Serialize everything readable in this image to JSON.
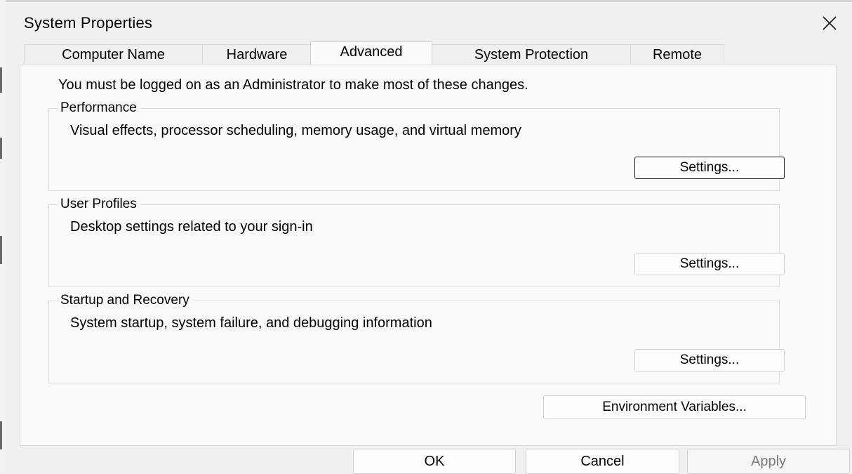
{
  "window": {
    "title": "System Properties"
  },
  "tabs": [
    {
      "label": "Computer Name",
      "active": false
    },
    {
      "label": "Hardware",
      "active": false
    },
    {
      "label": "Advanced",
      "active": true
    },
    {
      "label": "System Protection",
      "active": false
    },
    {
      "label": "Remote",
      "active": false
    }
  ],
  "advanced": {
    "notice": "You must be logged on as an Administrator to make most of these changes.",
    "performance": {
      "title": "Performance",
      "description": "Visual effects, processor scheduling, memory usage, and virtual memory",
      "button": "Settings..."
    },
    "user_profiles": {
      "title": "User Profiles",
      "description": "Desktop settings related to your sign-in",
      "button": "Settings..."
    },
    "startup_recovery": {
      "title": "Startup and Recovery",
      "description": "System startup, system failure, and debugging information",
      "button": "Settings..."
    },
    "env_button": "Environment Variables..."
  },
  "footer": {
    "ok": "OK",
    "cancel": "Cancel",
    "apply": "Apply"
  },
  "icons": {
    "close": "close-icon"
  },
  "colors": {
    "background": "#f0f0f0",
    "panel": "#fafafa",
    "border": "#dadada",
    "disabled_text": "#7a7a7a"
  }
}
